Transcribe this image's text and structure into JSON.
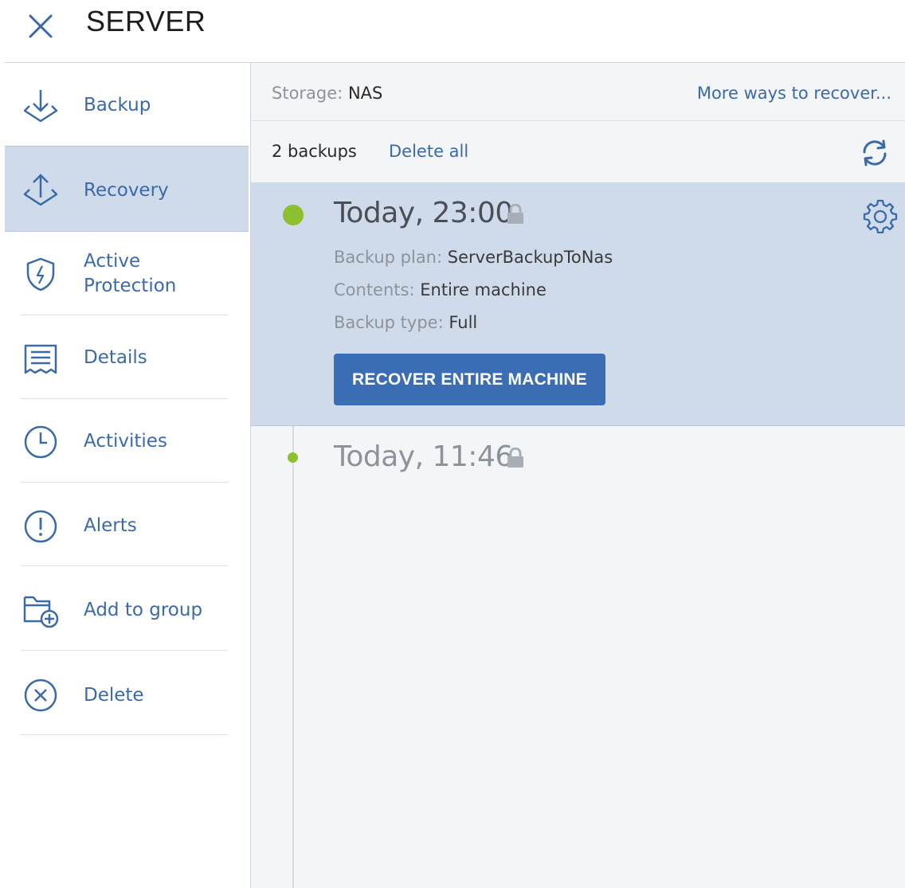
{
  "header": {
    "title": "SERVER",
    "close_icon": "close-icon"
  },
  "sidebar": {
    "items": [
      {
        "label": "Backup",
        "icon": "backup-icon",
        "active": false
      },
      {
        "label": "Recovery",
        "icon": "recovery-icon",
        "active": true
      },
      {
        "label": "Active\nProtection",
        "label_line1": "Active",
        "label_line2": "Protection",
        "icon": "shield-icon",
        "active": false
      },
      {
        "label": "Details",
        "icon": "details-icon",
        "active": false
      },
      {
        "label": "Activities",
        "icon": "clock-icon",
        "active": false
      },
      {
        "label": "Alerts",
        "icon": "alert-icon",
        "active": false
      },
      {
        "label": "Add to group",
        "icon": "add-to-group-icon",
        "active": false
      },
      {
        "label": "Delete",
        "icon": "delete-icon",
        "active": false
      }
    ]
  },
  "main": {
    "storage_label": "Storage:",
    "storage_value": "NAS",
    "more_ways": "More ways to recover...",
    "backup_count": "2 backups",
    "delete_all": "Delete all",
    "backups": [
      {
        "time": "Today, 23:00",
        "selected": true,
        "plan_label": "Backup plan:",
        "plan_value": "ServerBackupToNas",
        "contents_label": "Contents:",
        "contents_value": "Entire machine",
        "type_label": "Backup type:",
        "type_value": "Full",
        "action": "RECOVER ENTIRE MACHINE"
      },
      {
        "time": "Today, 11:46",
        "selected": false
      }
    ]
  },
  "colors": {
    "accent": "#3b6aa8",
    "selected_bg": "#cfdbeb",
    "status_dot": "#8cc02e",
    "button": "#3b6db4"
  }
}
